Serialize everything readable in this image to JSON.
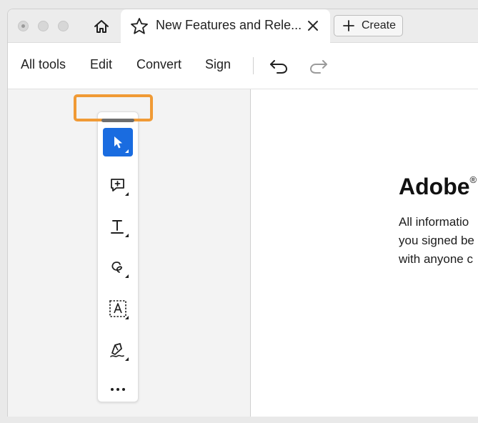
{
  "tab": {
    "title": "New Features and Rele..."
  },
  "create_button": {
    "label": "Create"
  },
  "toolbar": {
    "items": [
      "All tools",
      "Edit",
      "Convert",
      "Sign"
    ]
  },
  "quick_tools": [
    {
      "icon": "select-arrow-icon",
      "active": true
    },
    {
      "icon": "add-comment-icon",
      "active": false
    },
    {
      "icon": "text-tool-icon",
      "active": false
    },
    {
      "icon": "freehand-draw-icon",
      "active": false
    },
    {
      "icon": "text-box-select-icon",
      "active": false
    },
    {
      "icon": "pen-signature-icon",
      "active": false
    },
    {
      "icon": "more-icon",
      "active": false
    }
  ],
  "document": {
    "title": "Adobe",
    "title_mark": "®",
    "lines": [
      "All informatio",
      "you signed be",
      "with anyone c"
    ]
  },
  "colors": {
    "accent": "#1a6ce0",
    "highlight": "#f09a35",
    "panel_bg": "#f3f3f3",
    "titlebar_bg": "#ececec"
  }
}
